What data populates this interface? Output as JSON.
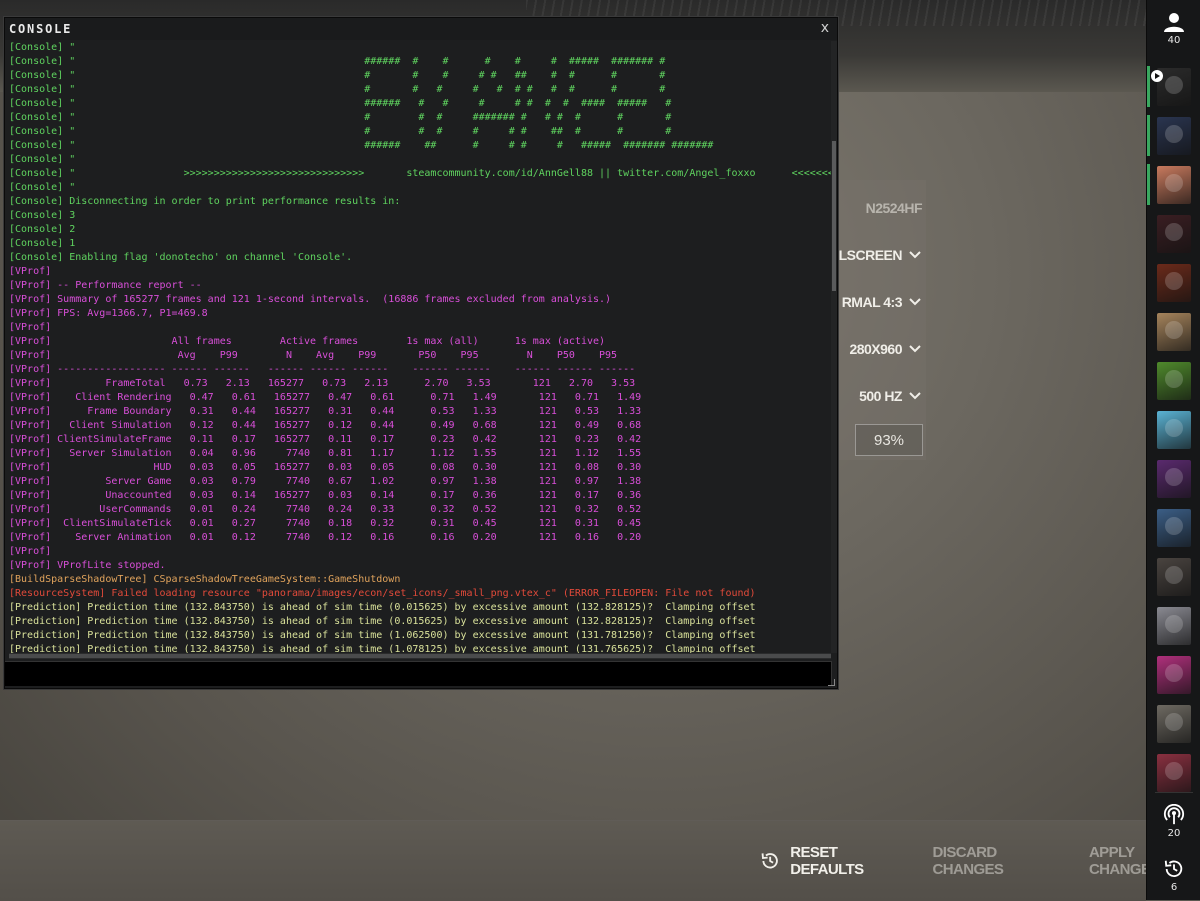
{
  "console": {
    "title": "CONSOLE",
    "close_glyph": "x",
    "log_lines": [
      {
        "text": "[Console] \"",
        "color": "#5fd35f"
      },
      {
        "text": "[Console] \"                                                ######  #    #      #    #     #  #####  ####### #",
        "color": "#5fd35f"
      },
      {
        "text": "[Console] \"                                                #       #    #     # #   ##    #  #      #       #",
        "color": "#5fd35f"
      },
      {
        "text": "[Console] \"                                                #       #   #     #   #  # #   #  #      #       #",
        "color": "#5fd35f"
      },
      {
        "text": "[Console] \"                                                ######   #   #     #     # #  #  #  ####  #####   #",
        "color": "#5fd35f"
      },
      {
        "text": "[Console] \"                                                #        #  #     ####### #   # #  #      #       #",
        "color": "#5fd35f"
      },
      {
        "text": "[Console] \"                                                #        #  #     #     # #    ##  #      #       #",
        "color": "#5fd35f"
      },
      {
        "text": "[Console] \"                                                ######    ##      #     # #     #   #####  ####### #######",
        "color": "#5fd35f"
      },
      {
        "text": "[Console] \"",
        "color": "#5fd35f"
      },
      {
        "text": "[Console] \"                  >>>>>>>>>>>>>>>>>>>>>>>>>>>>>>       steamcommunity.com/id/AnnGell88 || twitter.com/Angel_foxxo      <<<<<<<<<<<<<<<<",
        "color": "#5fd35f"
      },
      {
        "text": "[Console] \"",
        "color": "#5fd35f"
      },
      {
        "text": "[Console] Disconnecting in order to print performance results in:",
        "color": "#5fd35f"
      },
      {
        "text": "[Console] 3",
        "color": "#5fd35f"
      },
      {
        "text": "[Console] 2",
        "color": "#5fd35f"
      },
      {
        "text": "[Console] 1",
        "color": "#5fd35f"
      },
      {
        "text": "[Console] Enabling flag 'donotecho' on channel 'Console'.",
        "color": "#5fd35f"
      },
      {
        "text": "[VProf]",
        "color": "#d94fd9"
      },
      {
        "text": "[VProf] -- Performance report --",
        "color": "#d94fd9"
      },
      {
        "text": "[VProf] Summary of 165277 frames and 121 1-second intervals.  (16886 frames excluded from analysis.)",
        "color": "#d94fd9"
      },
      {
        "text": "[VProf] FPS: Avg=1366.7, P1=469.8",
        "color": "#d94fd9"
      },
      {
        "text": "[VProf]",
        "color": "#d94fd9"
      },
      {
        "text": "[VProf]                    All frames        Active frames        1s max (all)      1s max (active)",
        "color": "#d94fd9"
      },
      {
        "text": "[VProf]                     Avg    P99        N    Avg    P99       P50    P95        N    P50    P95",
        "color": "#d94fd9"
      },
      {
        "text": "[VProf] ------------------ ------ ------   ------ ------ ------    ------ ------    ------ ------ ------",
        "color": "#d94fd9"
      },
      {
        "text": "[VProf]         FrameTotal   0.73   2.13   165277   0.73   2.13      2.70   3.53       121   2.70   3.53",
        "color": "#d94fd9"
      },
      {
        "text": "[VProf]    Client Rendering   0.47   0.61   165277   0.47   0.61      0.71   1.49       121   0.71   1.49",
        "color": "#d94fd9"
      },
      {
        "text": "[VProf]      Frame Boundary   0.31   0.44   165277   0.31   0.44      0.53   1.33       121   0.53   1.33",
        "color": "#d94fd9"
      },
      {
        "text": "[VProf]   Client Simulation   0.12   0.44   165277   0.12   0.44      0.49   0.68       121   0.49   0.68",
        "color": "#d94fd9"
      },
      {
        "text": "[VProf] ClientSimulateFrame   0.11   0.17   165277   0.11   0.17      0.23   0.42       121   0.23   0.42",
        "color": "#d94fd9"
      },
      {
        "text": "[VProf]   Server Simulation   0.04   0.96     7740   0.81   1.17      1.12   1.55       121   1.12   1.55",
        "color": "#d94fd9"
      },
      {
        "text": "[VProf]                 HUD   0.03   0.05   165277   0.03   0.05      0.08   0.30       121   0.08   0.30",
        "color": "#d94fd9"
      },
      {
        "text": "[VProf]         Server Game   0.03   0.79     7740   0.67   1.02      0.97   1.38       121   0.97   1.38",
        "color": "#d94fd9"
      },
      {
        "text": "[VProf]         Unaccounted   0.03   0.14   165277   0.03   0.14      0.17   0.36       121   0.17   0.36",
        "color": "#d94fd9"
      },
      {
        "text": "[VProf]        UserCommands   0.01   0.24     7740   0.24   0.33      0.32   0.52       121   0.32   0.52",
        "color": "#d94fd9"
      },
      {
        "text": "[VProf]  ClientSimulateTick   0.01   0.27     7740   0.18   0.32      0.31   0.45       121   0.31   0.45",
        "color": "#d94fd9"
      },
      {
        "text": "[VProf]    Server Animation   0.01   0.12     7740   0.12   0.16      0.16   0.20       121   0.16   0.20",
        "color": "#d94fd9"
      },
      {
        "text": "[VProf]",
        "color": "#d94fd9"
      },
      {
        "text": "[VProf] VProfLite stopped.",
        "color": "#d94fd9"
      },
      {
        "text": "[BuildSparseShadowTree] CSparseShadowTreeGameSystem::GameShutdown",
        "color": "#e0a35c"
      },
      {
        "text": "[ResourceSystem] Failed loading resource \"panorama/images/econ/set_icons/_small_png.vtex_c\" (ERROR_FILEOPEN: File not found)",
        "color": "#e24a3a"
      },
      {
        "text": "[Prediction] Prediction time (132.843750) is ahead of sim time (0.015625) by excessive amount (132.828125)?  Clamping offset",
        "color": "#d9e19a"
      },
      {
        "text": "[Prediction] Prediction time (132.843750) is ahead of sim time (0.015625) by excessive amount (132.828125)?  Clamping offset",
        "color": "#d9e19a"
      },
      {
        "text": "[Prediction] Prediction time (132.843750) is ahead of sim time (1.062500) by excessive amount (131.781250)?  Clamping offset",
        "color": "#d9e19a"
      },
      {
        "text": "[Prediction] Prediction time (132.843750) is ahead of sim time (1.078125) by excessive amount (131.765625)?  Clamping offset",
        "color": "#d9e19a"
      }
    ]
  },
  "settings": {
    "monitor_partial": "N2524HF",
    "display_mode": "LLSCREEN",
    "aspect_ratio": "RMAL 4:3",
    "resolution": "280X960",
    "refresh_rate": "500 HZ",
    "percent_value": "93%"
  },
  "footer": {
    "reset_label": "RESET DEFAULTS",
    "discard_label": "DISCARD CHANGES",
    "apply_label": "APPLY CHANGES"
  },
  "sidebar": {
    "friends_count": "40",
    "avatars": [
      {
        "bg": "#2b2b2b",
        "bar": "#3aa860",
        "badge": true
      },
      {
        "bg": "#2a3550",
        "bar": "#3aa860",
        "badge": false
      },
      {
        "bg": "#c97a5e",
        "bar": "#3aa860",
        "badge": false
      },
      {
        "bg": "#3a1e22",
        "bar": "",
        "badge": false
      },
      {
        "bg": "#6b2a1a",
        "bar": "",
        "badge": false
      },
      {
        "bg": "#a6845c",
        "bar": "",
        "badge": false
      },
      {
        "bg": "#4f8a2c",
        "bar": "",
        "badge": false
      },
      {
        "bg": "#5ab3d4",
        "bar": "",
        "badge": false
      },
      {
        "bg": "#5a2a6e",
        "bar": "",
        "badge": false
      },
      {
        "bg": "#3b5e86",
        "bar": "",
        "badge": false
      },
      {
        "bg": "#4a4440",
        "bar": "",
        "badge": false
      },
      {
        "bg": "#8a8a92",
        "bar": "",
        "badge": false
      },
      {
        "bg": "#b0307c",
        "bar": "",
        "badge": false
      },
      {
        "bg": "#6e6a62",
        "bar": "",
        "badge": false
      },
      {
        "bg": "#8a3040",
        "bar": "",
        "badge": false
      }
    ],
    "broadcast_count": "20",
    "history_count": "6"
  }
}
